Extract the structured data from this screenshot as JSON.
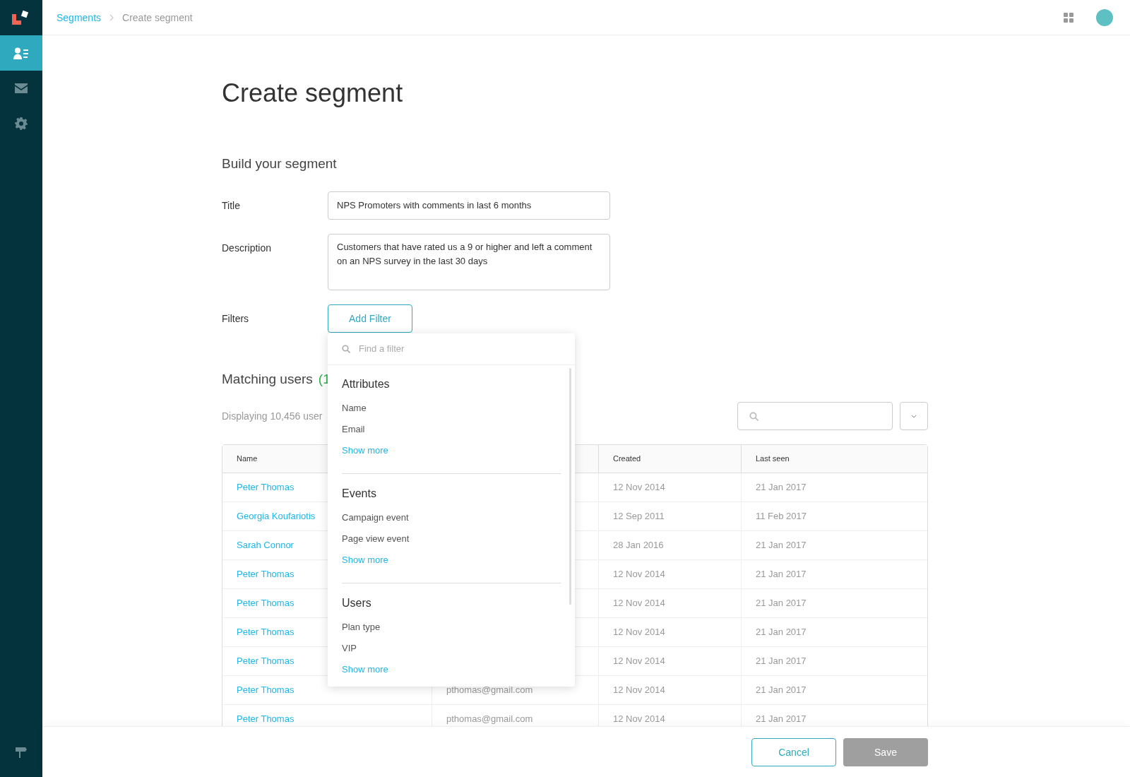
{
  "breadcrumb": [
    {
      "label": "Segments",
      "kind": "link"
    },
    {
      "label": "Create segment",
      "kind": "current"
    }
  ],
  "sidebar": {
    "items": [
      {
        "kind": "contacts",
        "selected": true
      },
      {
        "kind": "mail",
        "selected": false
      },
      {
        "kind": "settings",
        "selected": false
      }
    ]
  },
  "page_title": "Create segment",
  "section_title": "Build your segment",
  "form": {
    "title": {
      "label": "Title",
      "value": "NPS Promoters with comments in last 6 months"
    },
    "description": {
      "label": "Description",
      "value": "Customers that have rated us a 9 or higher and left a comment on an NPS survey in the last 30 days"
    },
    "filters": {
      "label": "Filters",
      "button": "Add Filter"
    }
  },
  "filter_menu": {
    "placeholder": "Find a filter",
    "groups": [
      {
        "title": "Attributes",
        "items": [
          "Name",
          "Email"
        ],
        "more": "Show more"
      },
      {
        "title": "Events",
        "items": [
          "Campaign event",
          "Page view event"
        ],
        "more": "Show more"
      },
      {
        "title": "Users",
        "items": [
          "Plan type",
          "VIP"
        ],
        "more": "Show more"
      }
    ]
  },
  "matching": {
    "title": "Matching users",
    "count": "(1",
    "displaying": "Displaying 10,456 user"
  },
  "table": {
    "columns": {
      "column_1": "Name",
      "column_3": "Created",
      "column_4": "Last seen"
    },
    "rows": [
      {
        "column_1": "Peter Thomas",
        "column_3": "12 Nov 2014",
        "column_4": "21 Jan 2017"
      },
      {
        "column_1": "Georgia Koufariotis",
        "column_3": "12 Sep 2011",
        "column_4": "11 Feb 2017"
      },
      {
        "column_1": "Sarah Connor",
        "column_3": "28 Jan 2016",
        "column_4": "21 Jan 2017"
      },
      {
        "column_1": "Peter Thomas",
        "column_3": "12 Nov 2014",
        "column_4": "21 Jan 2017"
      },
      {
        "column_1": "Peter Thomas",
        "column_3": "12 Nov 2014",
        "column_4": "21 Jan 2017"
      },
      {
        "column_1": "Peter Thomas",
        "column_3": "12 Nov 2014",
        "column_4": "21 Jan 2017"
      },
      {
        "column_1": "Peter Thomas",
        "column_3": "12 Nov 2014",
        "column_4": "21 Jan 2017"
      },
      {
        "column_1": "Peter Thomas",
        "column_2": "pthomas@gmail.com",
        "column_3": "12 Nov 2014",
        "column_4": "21 Jan 2017"
      },
      {
        "column_1": "Peter Thomas",
        "column_2": "pthomas@gmail.com",
        "column_3": "12 Nov 2014",
        "column_4": "21 Jan 2017"
      }
    ]
  },
  "footer": {
    "buttons": [
      {
        "label": "Cancel",
        "disabled": false
      },
      {
        "label": "Save",
        "disabled": true
      }
    ]
  }
}
